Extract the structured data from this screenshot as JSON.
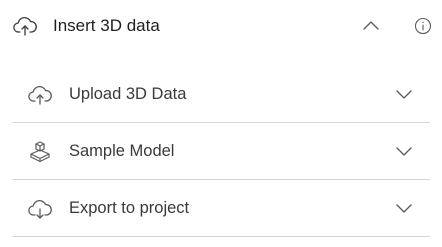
{
  "panel": {
    "title": "Insert 3D data",
    "title_icon": "cloud-upload-icon",
    "collapse_icon": "chevron-up-icon",
    "info_icon": "info-icon"
  },
  "items": [
    {
      "label": "Upload 3D Data",
      "icon": "cloud-upload-icon",
      "chevron": "chevron-down-icon"
    },
    {
      "label": "Sample Model",
      "icon": "cube-stack-icon",
      "chevron": "chevron-down-icon"
    },
    {
      "label": "Export to project",
      "icon": "cloud-download-icon",
      "chevron": "chevron-down-icon"
    }
  ],
  "colors": {
    "text": "#1f1f1f",
    "label": "#3a3a3a",
    "icon": "#5a5a5a",
    "divider": "#d6d6d6",
    "background": "#ffffff"
  }
}
